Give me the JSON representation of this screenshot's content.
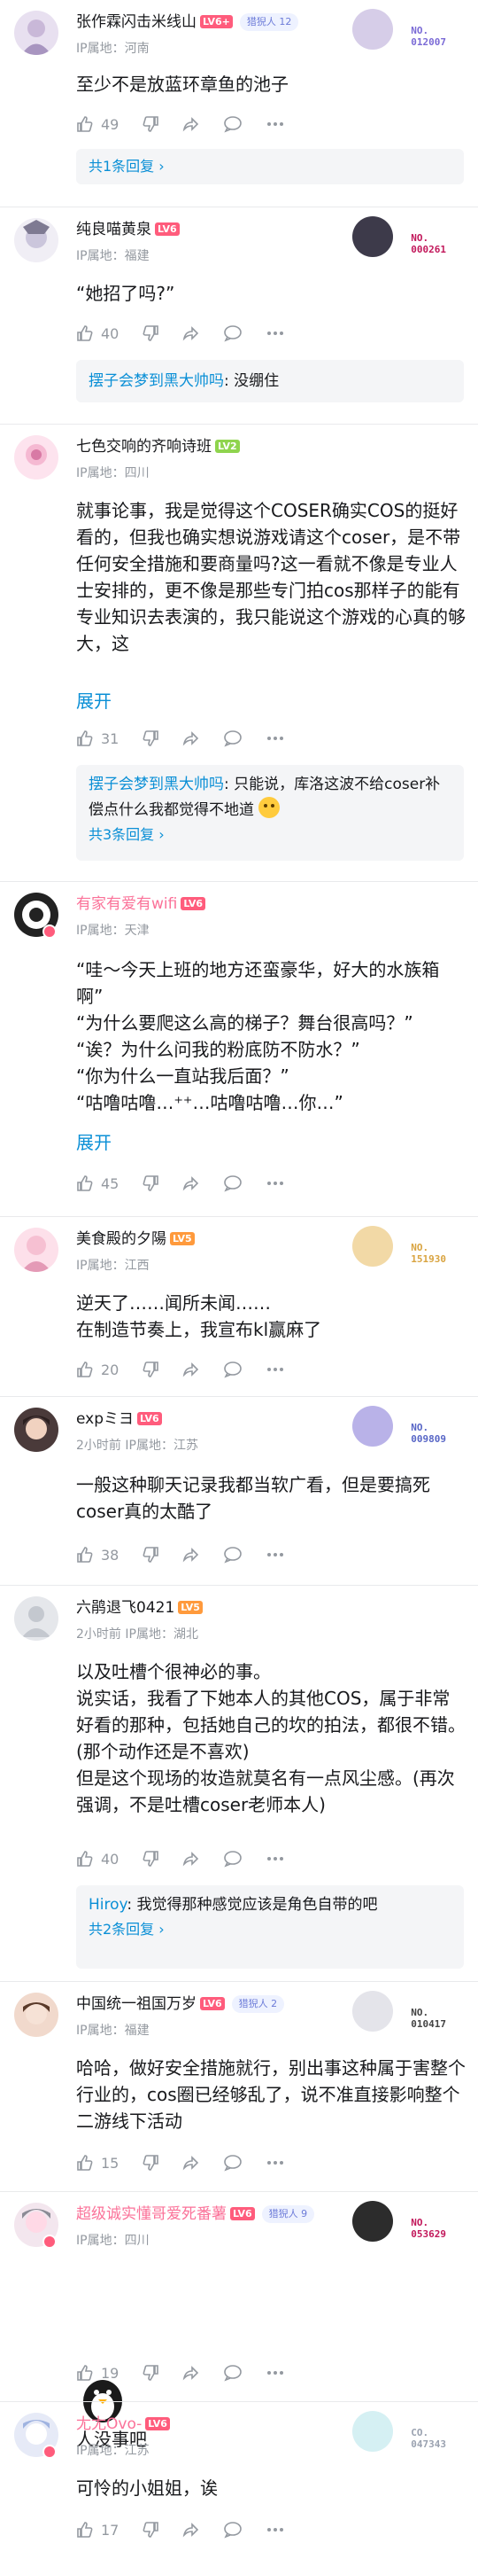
{
  "colors": {
    "link": "#0a8fd6",
    "meta": "#9499a0",
    "lv6": "#ff5c7c",
    "lv5": "#ff9a3c",
    "lv2": "#8fd44e"
  },
  "comments": [
    {
      "user": "张作霖闪击米线山",
      "level": "LV6+",
      "badge": "猎猊人",
      "badge_num": "12",
      "ip": "河南",
      "body": "至少不是放蓝环章鱼的池子",
      "likes": "49",
      "reply_more": "共1条回复 ›",
      "deco_no": "NO.\n012007"
    },
    {
      "user": "纯良喵黄泉",
      "level": "LV6",
      "ip": "福建",
      "body": "“她招了吗?”",
      "likes": "40",
      "reply_user": "摆子会梦到黑大帅吗",
      "reply_text": ": 没绷住",
      "deco_no": "NO.\n000261"
    },
    {
      "user": "七色交响的齐响诗班",
      "level": "LV2",
      "ip": "四川",
      "body": "就事论事，我是觉得这个COSER确实COS的挺好看的，但我也确实想说游戏请这个coser，是不带任何安全措施和要商量吗?这一看就不像是专业人士安排的，更不像是那些专门拍cos那样子的能有专业知识去表演的，我只能说这个游戏的心真的够大，这",
      "expand": "展开",
      "likes": "31",
      "reply_user": "摆子会梦到黑大帅吗",
      "reply_text": ": 只能说，库洛这波不给coser补偿点什么我都觉得不地道",
      "reply_more": "共3条回复 ›"
    },
    {
      "user": "有家有爱有wifi",
      "level": "LV6",
      "ip": "天津",
      "body": "“哇～今天上班的地方还蛮豪华，好大的水族箱啊”\n“为什么要爬这么高的梯子？舞台很高吗？”\n“诶？为什么问我的粉底防不防水？”\n“你为什么一直站我后面？”\n“咕噜咕噜…⁺⁺…咕噜咕噜…你…”",
      "expand": "展开",
      "likes": "45"
    },
    {
      "user": "美食殿的夕陽",
      "level": "LV5",
      "ip": "江西",
      "body": "逆天了……闻所未闻……\n在制造节奏上，我宣布kl赢麻了",
      "likes": "20",
      "deco_no": "NO.\n151930"
    },
    {
      "user": "expミヨ",
      "level": "LV6",
      "time": "2小时前",
      "ip": "江苏",
      "body": "一般这种聊天记录我都当软广看，但是要搞死coser真的太酷了",
      "likes": "38",
      "deco_no": "NO.\n009809"
    },
    {
      "user": "六鹃退飞0421",
      "level": "LV5",
      "time": "2小时前",
      "ip": "湖北",
      "body": "以及吐槽个很神必的事。\n说实话，我看了下她本人的其他COS，属于非常好看的那种，包括她自己的坎的拍法，都很不错。(那个动作还是不喜欢)\n但是这个现场的妆造就莫名有一点风尘感。(再次强调，不是吐槽coser老师本人)",
      "likes": "40",
      "reply_user": "Hiroy",
      "reply_text": ": 我觉得那种感觉应该是角色自带的吧",
      "reply_more": "共2条回复 ›"
    },
    {
      "user": "中国统一祖国万岁",
      "level": "LV6",
      "badge": "猎猊人",
      "badge_num": "2",
      "ip": "福建",
      "body": "哈哈，做好安全措施就行，别出事这种属于害整个行业的，cos圈已经够乱了，说不准直接影响整个二游线下活动",
      "likes": "15",
      "deco_no": "NO.\n010417"
    },
    {
      "user": "超级诚实懂哥爱死番薯",
      "level": "LV6",
      "badge": "猎猊人",
      "badge_num": "9",
      "ip": "四川",
      "body": "人没事吧",
      "likes": "19",
      "deco_no": "NO.\n053629"
    },
    {
      "user": "尢尢Ovo-",
      "level": "LV6",
      "ip": "江苏",
      "body": "可怜的小姐姐，诶",
      "likes": "17",
      "deco_no": "CO.\n047343"
    }
  ],
  "ip_prefix": "IP属地：",
  "ip_time_sep": "  "
}
